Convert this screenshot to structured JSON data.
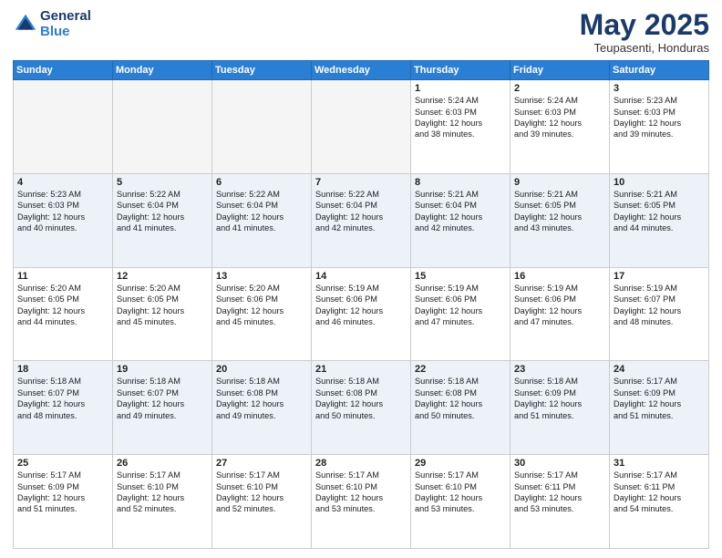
{
  "header": {
    "logo_line1": "General",
    "logo_line2": "Blue",
    "title": "May 2025",
    "subtitle": "Teupasenti, Honduras"
  },
  "days": [
    "Sunday",
    "Monday",
    "Tuesday",
    "Wednesday",
    "Thursday",
    "Friday",
    "Saturday"
  ],
  "weeks": [
    [
      {
        "day": "",
        "text": ""
      },
      {
        "day": "",
        "text": ""
      },
      {
        "day": "",
        "text": ""
      },
      {
        "day": "",
        "text": ""
      },
      {
        "day": "1",
        "text": "Sunrise: 5:24 AM\nSunset: 6:03 PM\nDaylight: 12 hours\nand 38 minutes."
      },
      {
        "day": "2",
        "text": "Sunrise: 5:24 AM\nSunset: 6:03 PM\nDaylight: 12 hours\nand 39 minutes."
      },
      {
        "day": "3",
        "text": "Sunrise: 5:23 AM\nSunset: 6:03 PM\nDaylight: 12 hours\nand 39 minutes."
      }
    ],
    [
      {
        "day": "4",
        "text": "Sunrise: 5:23 AM\nSunset: 6:03 PM\nDaylight: 12 hours\nand 40 minutes."
      },
      {
        "day": "5",
        "text": "Sunrise: 5:22 AM\nSunset: 6:04 PM\nDaylight: 12 hours\nand 41 minutes."
      },
      {
        "day": "6",
        "text": "Sunrise: 5:22 AM\nSunset: 6:04 PM\nDaylight: 12 hours\nand 41 minutes."
      },
      {
        "day": "7",
        "text": "Sunrise: 5:22 AM\nSunset: 6:04 PM\nDaylight: 12 hours\nand 42 minutes."
      },
      {
        "day": "8",
        "text": "Sunrise: 5:21 AM\nSunset: 6:04 PM\nDaylight: 12 hours\nand 42 minutes."
      },
      {
        "day": "9",
        "text": "Sunrise: 5:21 AM\nSunset: 6:05 PM\nDaylight: 12 hours\nand 43 minutes."
      },
      {
        "day": "10",
        "text": "Sunrise: 5:21 AM\nSunset: 6:05 PM\nDaylight: 12 hours\nand 44 minutes."
      }
    ],
    [
      {
        "day": "11",
        "text": "Sunrise: 5:20 AM\nSunset: 6:05 PM\nDaylight: 12 hours\nand 44 minutes."
      },
      {
        "day": "12",
        "text": "Sunrise: 5:20 AM\nSunset: 6:05 PM\nDaylight: 12 hours\nand 45 minutes."
      },
      {
        "day": "13",
        "text": "Sunrise: 5:20 AM\nSunset: 6:06 PM\nDaylight: 12 hours\nand 45 minutes."
      },
      {
        "day": "14",
        "text": "Sunrise: 5:19 AM\nSunset: 6:06 PM\nDaylight: 12 hours\nand 46 minutes."
      },
      {
        "day": "15",
        "text": "Sunrise: 5:19 AM\nSunset: 6:06 PM\nDaylight: 12 hours\nand 47 minutes."
      },
      {
        "day": "16",
        "text": "Sunrise: 5:19 AM\nSunset: 6:06 PM\nDaylight: 12 hours\nand 47 minutes."
      },
      {
        "day": "17",
        "text": "Sunrise: 5:19 AM\nSunset: 6:07 PM\nDaylight: 12 hours\nand 48 minutes."
      }
    ],
    [
      {
        "day": "18",
        "text": "Sunrise: 5:18 AM\nSunset: 6:07 PM\nDaylight: 12 hours\nand 48 minutes."
      },
      {
        "day": "19",
        "text": "Sunrise: 5:18 AM\nSunset: 6:07 PM\nDaylight: 12 hours\nand 49 minutes."
      },
      {
        "day": "20",
        "text": "Sunrise: 5:18 AM\nSunset: 6:08 PM\nDaylight: 12 hours\nand 49 minutes."
      },
      {
        "day": "21",
        "text": "Sunrise: 5:18 AM\nSunset: 6:08 PM\nDaylight: 12 hours\nand 50 minutes."
      },
      {
        "day": "22",
        "text": "Sunrise: 5:18 AM\nSunset: 6:08 PM\nDaylight: 12 hours\nand 50 minutes."
      },
      {
        "day": "23",
        "text": "Sunrise: 5:18 AM\nSunset: 6:09 PM\nDaylight: 12 hours\nand 51 minutes."
      },
      {
        "day": "24",
        "text": "Sunrise: 5:17 AM\nSunset: 6:09 PM\nDaylight: 12 hours\nand 51 minutes."
      }
    ],
    [
      {
        "day": "25",
        "text": "Sunrise: 5:17 AM\nSunset: 6:09 PM\nDaylight: 12 hours\nand 51 minutes."
      },
      {
        "day": "26",
        "text": "Sunrise: 5:17 AM\nSunset: 6:10 PM\nDaylight: 12 hours\nand 52 minutes."
      },
      {
        "day": "27",
        "text": "Sunrise: 5:17 AM\nSunset: 6:10 PM\nDaylight: 12 hours\nand 52 minutes."
      },
      {
        "day": "28",
        "text": "Sunrise: 5:17 AM\nSunset: 6:10 PM\nDaylight: 12 hours\nand 53 minutes."
      },
      {
        "day": "29",
        "text": "Sunrise: 5:17 AM\nSunset: 6:10 PM\nDaylight: 12 hours\nand 53 minutes."
      },
      {
        "day": "30",
        "text": "Sunrise: 5:17 AM\nSunset: 6:11 PM\nDaylight: 12 hours\nand 53 minutes."
      },
      {
        "day": "31",
        "text": "Sunrise: 5:17 AM\nSunset: 6:11 PM\nDaylight: 12 hours\nand 54 minutes."
      }
    ]
  ]
}
